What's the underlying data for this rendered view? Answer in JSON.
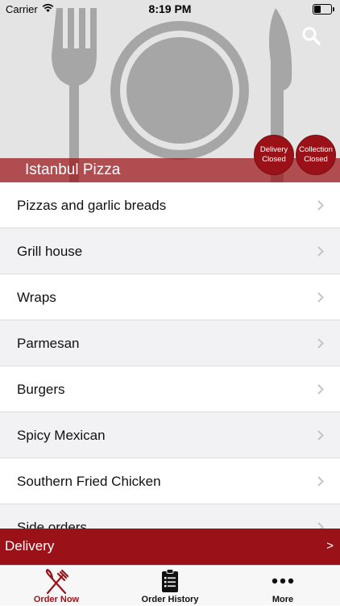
{
  "status_bar": {
    "carrier": "Carrier",
    "time": "8:19 PM"
  },
  "restaurant": {
    "name": "Istanbul Pizza"
  },
  "badges": {
    "delivery": {
      "line1": "Delivery",
      "line2": "Closed"
    },
    "collection": {
      "line1": "Collection",
      "line2": "Closed"
    }
  },
  "menu": {
    "items": [
      {
        "label": "Pizzas and garlic breads"
      },
      {
        "label": "Grill house"
      },
      {
        "label": "Wraps"
      },
      {
        "label": "Parmesan"
      },
      {
        "label": "Burgers"
      },
      {
        "label": "Spicy Mexican"
      },
      {
        "label": "Southern Fried Chicken"
      },
      {
        "label": "Side orders"
      }
    ]
  },
  "delivery_bar": {
    "label": "Delivery",
    "arrow": ">"
  },
  "tabs": [
    {
      "label": "Order Now",
      "icon": "fork-knife-icon",
      "active": true
    },
    {
      "label": "Order History",
      "icon": "clipboard-list-icon"
    },
    {
      "label": "More",
      "icon": "more-dots-icon"
    }
  ],
  "colors": {
    "accent": "#9a1218",
    "hero_bg": "#e4e4e4"
  }
}
